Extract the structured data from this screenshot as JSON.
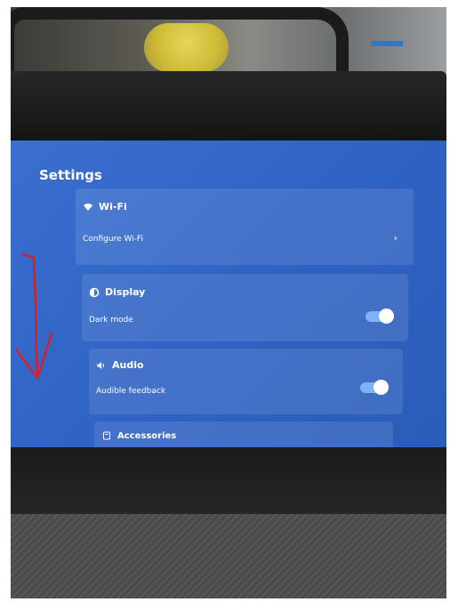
{
  "screen": {
    "title": "Settings",
    "wifi": {
      "header": "Wi-Fi",
      "item_label": "Configure Wi-Fi",
      "icon": "wifi-icon",
      "chevron": "›"
    },
    "display": {
      "header": "Display",
      "item_label": "Dark mode",
      "icon": "contrast-icon",
      "toggle_on": true
    },
    "audio": {
      "header": "Audio",
      "item_label": "Audible feedback",
      "icon": "speaker-icon",
      "toggle_on": true
    },
    "accessories": {
      "header": "Accessories",
      "icon": "accessory-icon"
    }
  },
  "annotation": {
    "color": "#d4202a"
  },
  "colors": {
    "screen_blue": "#2f63c4",
    "toggle_track": "#7fb3f5"
  }
}
